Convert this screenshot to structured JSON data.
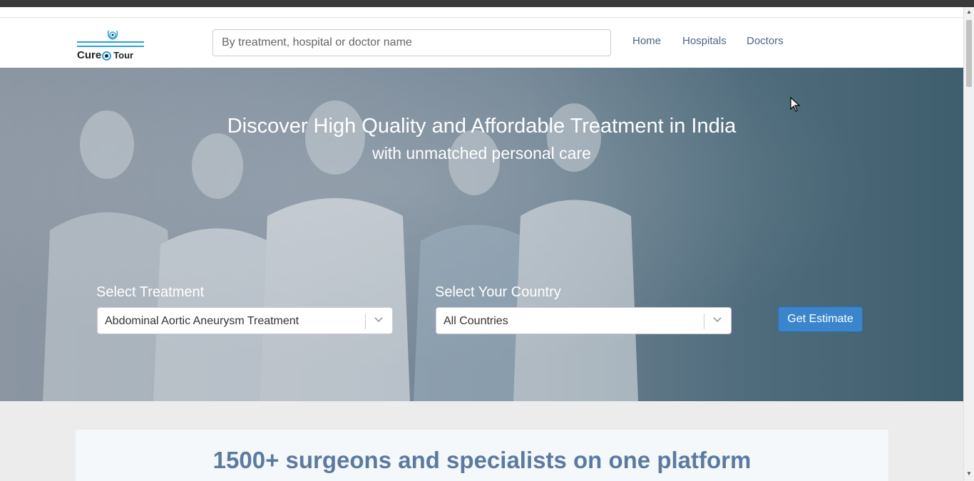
{
  "brand": {
    "name_part1": "Cure",
    "name_part2": "Tour"
  },
  "search": {
    "placeholder": "By treatment, hospital or doctor name"
  },
  "nav": {
    "home": "Home",
    "hospitals": "Hospitals",
    "doctors": "Doctors"
  },
  "hero": {
    "title": "Discover High Quality and Affordable Treatment in India",
    "subtitle": "with unmatched personal care",
    "treatment_label": "Select Treatment",
    "treatment_value": "Abdominal Aortic Aneurysm Treatment",
    "country_label": "Select Your Country",
    "country_value": "All Countries",
    "button_label": "Get Estimate"
  },
  "section": {
    "title": "1500+ surgeons and specialists on one platform"
  },
  "colors": {
    "accent": "#3a85cc",
    "nav_link": "#4d6782",
    "logo_blue": "#29a3d8",
    "section_title": "#5c7aa0"
  }
}
